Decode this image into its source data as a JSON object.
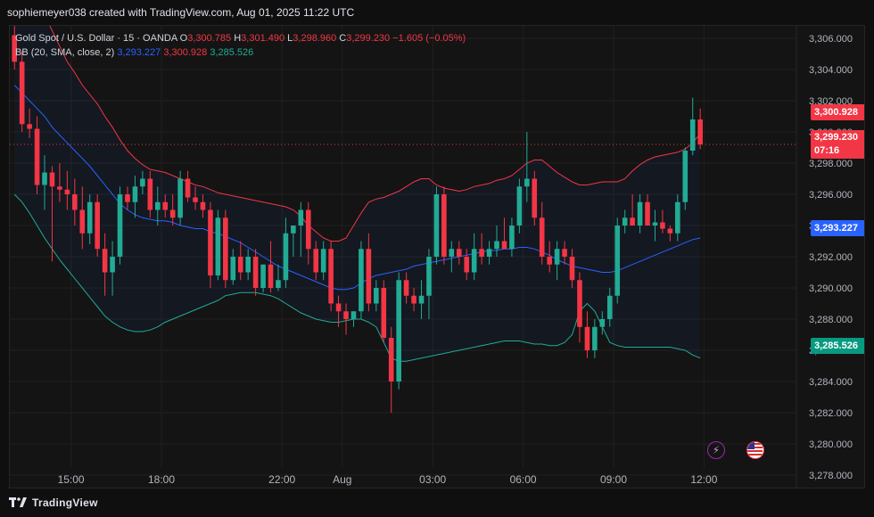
{
  "header": {
    "attribution": "sophiemeyer038 created with TradingView.com, Aug 01, 2025 11:22 UTC"
  },
  "legend": {
    "symbol": "Gold Spot / U.S. Dollar · 15 · OANDA",
    "o_label": "O",
    "o_value": "3,300.785",
    "h_label": "H",
    "h_value": "3,301.490",
    "l_label": "L",
    "l_value": "3,298.960",
    "c_label": "C",
    "c_value": "3,299.230",
    "change": "−1.605 (−0.05%)",
    "bb_label": "BB (20, SMA, close, 2)",
    "bb_basis": "3,293.227",
    "bb_upper": "3,300.928",
    "bb_lower": "3,285.526"
  },
  "price_badges": {
    "upper": "3,300.928",
    "close": "3,299.230",
    "countdown": "07:16",
    "basis": "3,293.227",
    "lower": "3,285.526"
  },
  "footer": {
    "brand": "TradingView"
  },
  "colors": {
    "up": "#22ab94",
    "down": "#f23645",
    "basis": "#2962ff",
    "upper": "#f23645",
    "lower": "#22ab94",
    "background": "#141414"
  },
  "icons": {
    "lightning": "lightning-icon",
    "flag": "us-flag-icon",
    "logo": "tradingview-logo-icon"
  },
  "chart_data": {
    "type": "candlestick",
    "ylim": [
      3277.2,
      3306.8
    ],
    "y_ticks": [
      "3,306.000",
      "3,304.000",
      "3,302.000",
      "3,300.000",
      "3,298.000",
      "3,296.000",
      "3,294.000",
      "3,292.000",
      "3,290.000",
      "3,288.000",
      "3,286.000",
      "3,284.000",
      "3,282.000",
      "3,280.000",
      "3,278.000"
    ],
    "y_tick_values": [
      3306,
      3304,
      3302,
      3300,
      3298,
      3296,
      3294,
      3292,
      3290,
      3288,
      3286,
      3284,
      3282,
      3280,
      3278
    ],
    "x_ticks": [
      {
        "label": "15:00",
        "i": 7.5
      },
      {
        "label": "18:00",
        "i": 19.5
      },
      {
        "label": "22:00",
        "i": 35.5
      },
      {
        "label": "Aug",
        "i": 43.5
      },
      {
        "label": "03:00",
        "i": 55.5
      },
      {
        "label": "06:00",
        "i": 67.5
      },
      {
        "label": "09:00",
        "i": 79.5
      },
      {
        "label": "12:00",
        "i": 91.5
      }
    ],
    "candles": [
      [
        3306.2,
        3306.8,
        3304.0,
        3304.5
      ],
      [
        3304.5,
        3305.2,
        3300.0,
        3300.5
      ],
      [
        3300.5,
        3301.5,
        3299.6,
        3300.2
      ],
      [
        3300.2,
        3301.0,
        3296.0,
        3296.6
      ],
      [
        3296.6,
        3298.5,
        3295.0,
        3297.4
      ],
      [
        3297.4,
        3297.8,
        3291.7,
        3296.5
      ],
      [
        3296.5,
        3298.0,
        3295.5,
        3296.3
      ],
      [
        3296.3,
        3297.5,
        3295.0,
        3296.0
      ],
      [
        3296.0,
        3297.0,
        3294.0,
        3295.0
      ],
      [
        3295.0,
        3296.5,
        3292.5,
        3293.5
      ],
      [
        3293.5,
        3296.0,
        3292.8,
        3295.5
      ],
      [
        3295.5,
        3296.0,
        3292.0,
        3292.5
      ],
      [
        3292.5,
        3293.5,
        3289.5,
        3291.0
      ],
      [
        3291.0,
        3293.0,
        3289.5,
        3292.0
      ],
      [
        3292.0,
        3296.5,
        3291.5,
        3296.0
      ],
      [
        3296.0,
        3296.5,
        3295.0,
        3295.5
      ],
      [
        3295.5,
        3297.2,
        3294.5,
        3296.5
      ],
      [
        3296.5,
        3297.5,
        3296.0,
        3297.0
      ],
      [
        3297.0,
        3297.5,
        3294.5,
        3295.0
      ],
      [
        3295.0,
        3296.5,
        3294.0,
        3295.5
      ],
      [
        3295.5,
        3296.0,
        3294.5,
        3295.0
      ],
      [
        3295.0,
        3296.0,
        3294.0,
        3294.5
      ],
      [
        3294.5,
        3297.5,
        3294.0,
        3297.0
      ],
      [
        3297.0,
        3297.5,
        3295.5,
        3295.8
      ],
      [
        3295.8,
        3296.5,
        3295.0,
        3295.5
      ],
      [
        3295.5,
        3296.0,
        3294.5,
        3295.0
      ],
      [
        3295.0,
        3295.5,
        3290.0,
        3290.8
      ],
      [
        3290.8,
        3295.0,
        3290.5,
        3294.5
      ],
      [
        3294.5,
        3295.0,
        3290.0,
        3290.5
      ],
      [
        3290.5,
        3292.5,
        3290.2,
        3292.0
      ],
      [
        3292.0,
        3293.0,
        3290.5,
        3291.0
      ],
      [
        3291.0,
        3292.5,
        3290.5,
        3292.0
      ],
      [
        3292.0,
        3292.5,
        3289.5,
        3290.0
      ],
      [
        3290.0,
        3291.5,
        3289.7,
        3291.5
      ],
      [
        3291.5,
        3293.0,
        3289.7,
        3290.0
      ],
      [
        3290.0,
        3291.5,
        3289.8,
        3290.5
      ],
      [
        3290.5,
        3294.5,
        3290.0,
        3293.5
      ],
      [
        3293.5,
        3294.0,
        3292.0,
        3294.0
      ],
      [
        3294.0,
        3295.5,
        3292.0,
        3295.0
      ],
      [
        3295.0,
        3295.5,
        3291.5,
        3292.5
      ],
      [
        3292.5,
        3293.0,
        3290.5,
        3291.0
      ],
      [
        3291.0,
        3293.0,
        3290.5,
        3292.5
      ],
      [
        3292.5,
        3293.0,
        3288.5,
        3289.0
      ],
      [
        3289.0,
        3289.5,
        3287.5,
        3288.5
      ],
      [
        3288.5,
        3289.0,
        3287.0,
        3288.0
      ],
      [
        3288.0,
        3288.5,
        3287.5,
        3288.5
      ],
      [
        3288.5,
        3293.0,
        3288.0,
        3292.5
      ],
      [
        3292.5,
        3293.5,
        3288.5,
        3289.0
      ],
      [
        3289.0,
        3290.5,
        3288.5,
        3290.0
      ],
      [
        3290.0,
        3290.5,
        3286.5,
        3286.8
      ],
      [
        3286.8,
        3287.5,
        3282.0,
        3284.0
      ],
      [
        3284.0,
        3291.0,
        3283.5,
        3290.5
      ],
      [
        3290.5,
        3291.0,
        3289.0,
        3289.5
      ],
      [
        3289.5,
        3290.0,
        3288.5,
        3289.0
      ],
      [
        3289.0,
        3290.5,
        3288.0,
        3289.5
      ],
      [
        3289.5,
        3292.5,
        3288.0,
        3292.0
      ],
      [
        3292.0,
        3296.5,
        3291.5,
        3296.0
      ],
      [
        3296.0,
        3296.5,
        3291.5,
        3292.0
      ],
      [
        3292.0,
        3293.0,
        3291.0,
        3292.5
      ],
      [
        3292.5,
        3293.0,
        3291.5,
        3292.0
      ],
      [
        3292.0,
        3292.5,
        3290.5,
        3291.0
      ],
      [
        3291.0,
        3293.5,
        3290.5,
        3292.5
      ],
      [
        3292.5,
        3293.5,
        3291.5,
        3292.0
      ],
      [
        3292.0,
        3293.0,
        3291.5,
        3292.5
      ],
      [
        3292.5,
        3294.0,
        3292.0,
        3293.0
      ],
      [
        3293.0,
        3294.5,
        3292.5,
        3292.5
      ],
      [
        3292.5,
        3294.5,
        3292.0,
        3294.0
      ],
      [
        3294.0,
        3297.0,
        3293.5,
        3296.5
      ],
      [
        3296.5,
        3300.0,
        3295.5,
        3297.0
      ],
      [
        3297.0,
        3297.5,
        3294.0,
        3294.5
      ],
      [
        3294.5,
        3295.5,
        3291.5,
        3292.0
      ],
      [
        3292.0,
        3293.0,
        3291.0,
        3291.5
      ],
      [
        3291.5,
        3293.0,
        3290.5,
        3292.5
      ],
      [
        3292.5,
        3293.0,
        3291.5,
        3292.0
      ],
      [
        3292.0,
        3292.5,
        3290.0,
        3290.5
      ],
      [
        3290.5,
        3291.0,
        3286.5,
        3287.5
      ],
      [
        3287.5,
        3288.5,
        3285.5,
        3286.0
      ],
      [
        3286.0,
        3288.0,
        3285.5,
        3287.5
      ],
      [
        3287.5,
        3288.5,
        3287.0,
        3288.0
      ],
      [
        3288.0,
        3290.0,
        3287.5,
        3289.5
      ],
      [
        3289.5,
        3294.5,
        3289.0,
        3294.0
      ],
      [
        3294.0,
        3295.0,
        3293.5,
        3294.5
      ],
      [
        3294.5,
        3296.0,
        3294.0,
        3294.0
      ],
      [
        3294.0,
        3296.0,
        3293.5,
        3295.5
      ],
      [
        3295.5,
        3296.0,
        3294.5,
        3294.0
      ],
      [
        3294.0,
        3295.0,
        3293.0,
        3294.2
      ],
      [
        3294.2,
        3295.0,
        3293.5,
        3293.8
      ],
      [
        3293.8,
        3294.0,
        3293.0,
        3293.5
      ],
      [
        3293.5,
        3296.0,
        3293.0,
        3295.5
      ],
      [
        3295.5,
        3299.0,
        3295.0,
        3298.8
      ],
      [
        3298.8,
        3302.2,
        3298.5,
        3300.8
      ],
      [
        3300.8,
        3301.5,
        3298.9,
        3299.2
      ]
    ],
    "bb_upper": [
      3310.0,
      3309.5,
      3308.8,
      3308.2,
      3307.5,
      3306.5,
      3305.5,
      3304.5,
      3303.8,
      3303.0,
      3302.4,
      3301.8,
      3301.0,
      3300.3,
      3299.5,
      3298.8,
      3298.3,
      3297.9,
      3297.6,
      3297.5,
      3297.4,
      3297.2,
      3297.0,
      3296.8,
      3296.6,
      3296.5,
      3296.3,
      3296.1,
      3296.0,
      3295.9,
      3295.8,
      3295.7,
      3295.6,
      3295.5,
      3295.4,
      3295.3,
      3295.2,
      3295.0,
      3294.6,
      3294.0,
      3293.6,
      3293.2,
      3293.0,
      3293.0,
      3293.2,
      3294.0,
      3294.8,
      3295.5,
      3295.7,
      3295.8,
      3296.0,
      3296.2,
      3296.5,
      3296.8,
      3297.0,
      3297.0,
      3296.6,
      3296.4,
      3296.3,
      3296.2,
      3296.3,
      3296.5,
      3296.6,
      3296.7,
      3296.9,
      3297.0,
      3297.2,
      3297.6,
      3298.0,
      3298.2,
      3298.2,
      3297.8,
      3297.4,
      3297.1,
      3296.8,
      3296.6,
      3296.6,
      3296.7,
      3296.8,
      3296.8,
      3296.8,
      3297.0,
      3297.5,
      3297.9,
      3298.2,
      3298.4,
      3298.5,
      3298.6,
      3298.7,
      3298.9,
      3299.3,
      3299.9
    ],
    "bb_basis": [
      3303.0,
      3302.5,
      3302.0,
      3301.5,
      3301.0,
      3300.3,
      3299.8,
      3299.3,
      3298.8,
      3298.3,
      3297.8,
      3297.2,
      3296.6,
      3296.0,
      3295.4,
      3295.0,
      3294.7,
      3294.5,
      3294.4,
      3294.3,
      3294.3,
      3294.2,
      3294.0,
      3293.9,
      3293.8,
      3293.8,
      3293.6,
      3293.5,
      3293.3,
      3293.1,
      3292.9,
      3292.6,
      3292.3,
      3292.0,
      3291.7,
      3291.4,
      3291.2,
      3291.0,
      3290.8,
      3290.6,
      3290.4,
      3290.2,
      3290.0,
      3289.9,
      3289.9,
      3290.0,
      3290.3,
      3290.6,
      3290.8,
      3290.9,
      3291.0,
      3291.1,
      3291.2,
      3291.4,
      3291.5,
      3291.6,
      3291.7,
      3291.8,
      3291.9,
      3292.0,
      3292.1,
      3292.2,
      3292.3,
      3292.4,
      3292.4,
      3292.5,
      3292.5,
      3292.6,
      3292.6,
      3292.5,
      3292.3,
      3292.1,
      3291.8,
      3291.6,
      3291.4,
      3291.3,
      3291.2,
      3291.1,
      3291.0,
      3291.0,
      3291.1,
      3291.3,
      3291.5,
      3291.7,
      3291.9,
      3292.1,
      3292.3,
      3292.5,
      3292.7,
      3292.9,
      3293.1,
      3293.2
    ],
    "bb_lower": [
      3296.0,
      3295.5,
      3294.8,
      3294.0,
      3293.2,
      3292.5,
      3291.8,
      3291.2,
      3290.6,
      3290.0,
      3289.4,
      3288.8,
      3288.2,
      3287.8,
      3287.5,
      3287.3,
      3287.2,
      3287.2,
      3287.3,
      3287.5,
      3287.8,
      3288.0,
      3288.2,
      3288.4,
      3288.6,
      3288.8,
      3289.0,
      3289.2,
      3289.5,
      3289.6,
      3289.7,
      3289.7,
      3289.7,
      3289.6,
      3289.5,
      3289.3,
      3289.0,
      3288.7,
      3288.4,
      3288.2,
      3288.0,
      3287.9,
      3287.8,
      3287.8,
      3287.9,
      3288.0,
      3288.0,
      3287.8,
      3287.5,
      3286.5,
      3285.5,
      3285.3,
      3285.3,
      3285.4,
      3285.5,
      3285.6,
      3285.7,
      3285.8,
      3285.9,
      3286.0,
      3286.1,
      3286.2,
      3286.3,
      3286.4,
      3286.5,
      3286.6,
      3286.6,
      3286.6,
      3286.5,
      3286.4,
      3286.4,
      3286.3,
      3286.3,
      3286.5,
      3287.0,
      3288.5,
      3289.0,
      3288.5,
      3287.5,
      3286.5,
      3286.3,
      3286.2,
      3286.2,
      3286.2,
      3286.2,
      3286.2,
      3286.2,
      3286.2,
      3286.1,
      3286.0,
      3285.7,
      3285.5
    ]
  }
}
